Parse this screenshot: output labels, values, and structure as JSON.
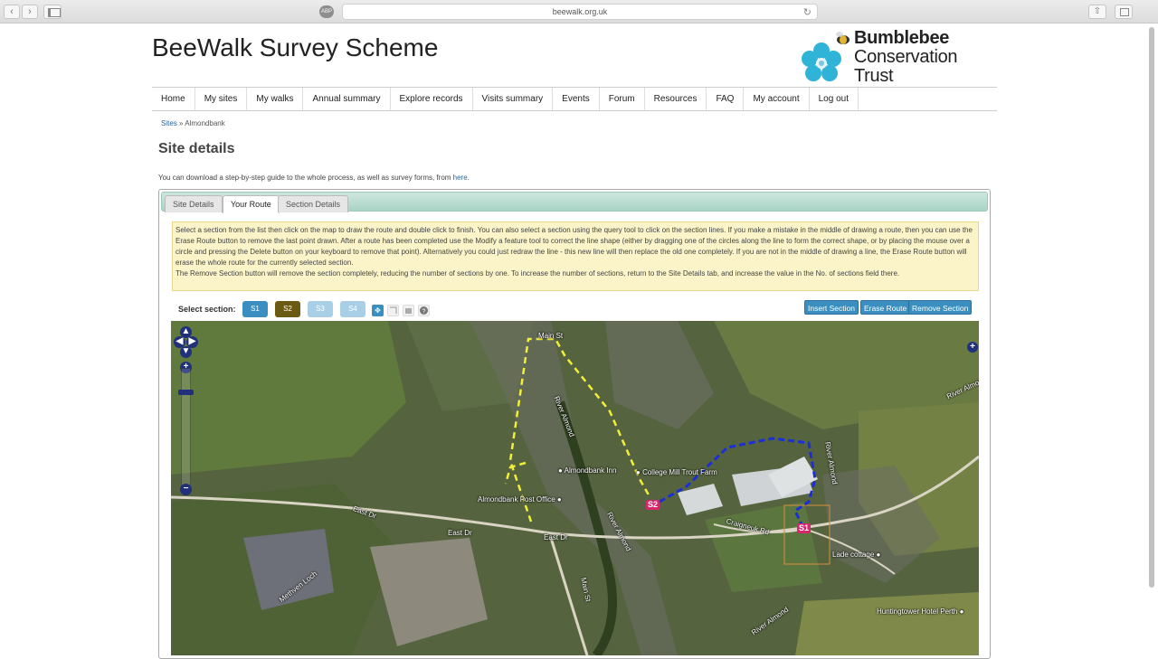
{
  "browser": {
    "url": "beewalk.org.uk",
    "back_glyph": "‹",
    "forward_glyph": "›",
    "reload_glyph": "↻",
    "share_glyph": "⇧",
    "ext_label": "ABP"
  },
  "header": {
    "site_title": "BeeWalk Survey Scheme",
    "logo_line1": "Bumblebee",
    "logo_line2": "Conservation",
    "logo_line3": "Trust"
  },
  "menu": {
    "items": [
      {
        "label": "Home"
      },
      {
        "label": "My sites"
      },
      {
        "label": "My walks"
      },
      {
        "label": "Annual summary"
      },
      {
        "label": "Explore records"
      },
      {
        "label": "Visits summary"
      },
      {
        "label": "Events"
      },
      {
        "label": "Forum"
      },
      {
        "label": "Resources"
      },
      {
        "label": "FAQ"
      },
      {
        "label": "My account"
      },
      {
        "label": "Log out"
      }
    ]
  },
  "breadcrumb": {
    "link": "Sites",
    "separator": " » ",
    "current": "Almondbank"
  },
  "page": {
    "heading": "Site details",
    "intro_text": "You can download a step-by-step guide to the whole process, as well as survey forms, from ",
    "intro_link": "here",
    "intro_end": "."
  },
  "tabs": [
    {
      "label": "Site Details"
    },
    {
      "label": "Your Route"
    },
    {
      "label": "Section Details"
    }
  ],
  "instructions": {
    "para1": "Select a section from the list then click on the map to draw the route and double click to finish. You can also select a section using the query tool to click on the section lines. If you make a mistake in the middle of drawing a route, then you can use the Erase Route button to remove the last point drawn. After a route has been completed use the Modify a feature tool to correct the line shape (either by dragging one of the circles along the line to form the correct shape, or by placing the mouse over a circle and pressing the Delete button on your keyboard to remove that point). Alternatively you could just redraw the line - this new line will then replace the old one completely. If you are not in the middle of drawing a line, the Erase Route button will erase the whole route for the currently selected section.",
    "para2": "The Remove Section button will remove the section completely, reducing the number of sections by one. To increase the number of sections, return to the Site Details tab, and increase the value in the No. of sections field there."
  },
  "sections": {
    "label": "Select section:",
    "buttons": [
      {
        "label": "S1",
        "color": "#3a8fc0"
      },
      {
        "label": "S2",
        "color": "#6b5a12"
      },
      {
        "label": "S3",
        "color": "#a9cfe6"
      },
      {
        "label": "S4",
        "color": "#a9cfe6"
      }
    ]
  },
  "actions": {
    "insert": "Insert Section",
    "erase": "Erase Route",
    "remove": "Remove Section"
  },
  "map": {
    "labels": {
      "main_st_top": "Main St",
      "river_almond_1": "River Almond",
      "river_almond_2": "River Almond",
      "river_almond_3": "River Almond",
      "river_almond_4": "River Almond",
      "river_almond_5": "River Almond",
      "almondbank_inn": "Almondbank Inn",
      "college_mill": "College Mill Trout Farm",
      "post_office": "Almondbank Post Office",
      "east_dr_1": "East Dr",
      "east_dr_2": "East Dr",
      "east_dr_3": "East Dr",
      "craigneuk_rd": "Craigneuk Rd",
      "lade_cottage": "Lade cottage",
      "methven_loch": "Methven Loch",
      "main_st_bottom": "Main St",
      "huntingtower": "Huntingtower Hotel Perth",
      "s1_marker": "S1",
      "s2_marker": "S2"
    },
    "route_colors": {
      "s1": "#1a2fd6",
      "s2": "#f2ee3a"
    }
  }
}
